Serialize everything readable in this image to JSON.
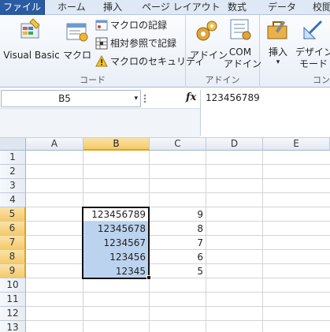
{
  "tabs": [
    "ファイル",
    "ホーム",
    "挿入",
    "ページ レイアウト",
    "数式",
    "データ",
    "校閲"
  ],
  "ribbon": {
    "code_group": {
      "label": "コード",
      "visual_basic": "Visual Basic",
      "macro": "マクロ",
      "record_macro": "マクロの記録",
      "relative_ref": "相対参照で記録",
      "macro_security": "マクロのセキュリティ"
    },
    "addin_group": {
      "label": "アドイン",
      "addin": "アドイン",
      "com_addin_line1": "COM",
      "com_addin_line2": "アドイン"
    },
    "controls_group": {
      "label": "コン",
      "insert": "挿入",
      "insert_arrow": "▾",
      "design_line1": "デザイン",
      "design_line2": "モード"
    }
  },
  "formula_bar": {
    "name_box": "B5",
    "name_box_arrow": "▾",
    "fx": "fx",
    "value": "123456789"
  },
  "grid": {
    "columns": [
      "A",
      "B",
      "C",
      "D",
      "E"
    ],
    "selected_column": "B",
    "rows": [
      "1",
      "2",
      "3",
      "4",
      "5",
      "6",
      "7",
      "8",
      "9",
      "10",
      "11",
      "12",
      "13"
    ],
    "selected_rows": [
      "5",
      "6",
      "7",
      "8",
      "9"
    ],
    "column_b": [
      "123456789",
      "12345678",
      "1234567",
      "123456",
      "12345"
    ],
    "column_c": [
      "9",
      "8",
      "7",
      "6",
      "5"
    ]
  },
  "colors": {
    "file_tab": "#2a5ba3",
    "selection_fill": "#bcd3ef",
    "header_selected": "#f4c96b"
  }
}
